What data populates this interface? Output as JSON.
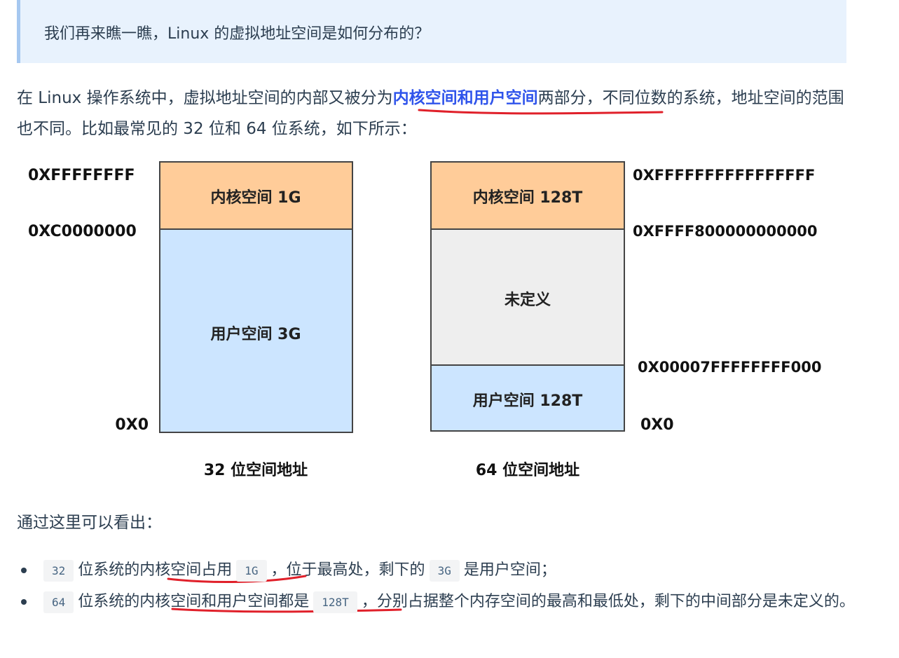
{
  "quote": {
    "text": "我们再来瞧一瞧，Linux 的虚拟地址空间是如何分布的？"
  },
  "intro": {
    "before": "在 Linux 操作系统中，虚拟地址空间的内部又被分为",
    "highlight": "内核空间和用户空间",
    "after": "两部分，不同位数的系统，地址空间的范围也不同。比如最常见的 32 位和 64 位系统，如下所示："
  },
  "diagram": {
    "left": {
      "top_addr": "0XFFFFFFFF",
      "mid_addr": "0XC0000000",
      "bottom_addr": "0X0",
      "kernel_label": "内核空间 1G",
      "user_label": "用户空间 3G",
      "caption": "32 位空间地址"
    },
    "right": {
      "top_addr": "0XFFFFFFFFFFFFFFFF",
      "mid_addr": "0XFFFF800000000000",
      "low_addr": "0X00007FFFFFFFF000",
      "bottom_addr": "0X0",
      "kernel_label": "内核空间 128T",
      "undefined_label": "未定义",
      "user_label": "用户空间 128T",
      "caption": "64 位空间地址"
    },
    "colors": {
      "kernel": "#ffcc99",
      "user": "#cce5ff",
      "undefined": "#eeeeee"
    }
  },
  "summary": {
    "lead": "通过这里可以看出："
  },
  "bullets": [
    {
      "c1": "32",
      "t1": "位系统的内核空间占用",
      "c2": "1G",
      "t2": "，位于最高处，剩下的",
      "c3": "3G",
      "t3": "是用户空间；"
    },
    {
      "c1": "64",
      "t1": "位系统的内核空间和用户空间都是",
      "c2": "128T",
      "t2": "，分别占据整个内存空间的最高和最低处，剩下的中间部分是未定义的。"
    }
  ]
}
